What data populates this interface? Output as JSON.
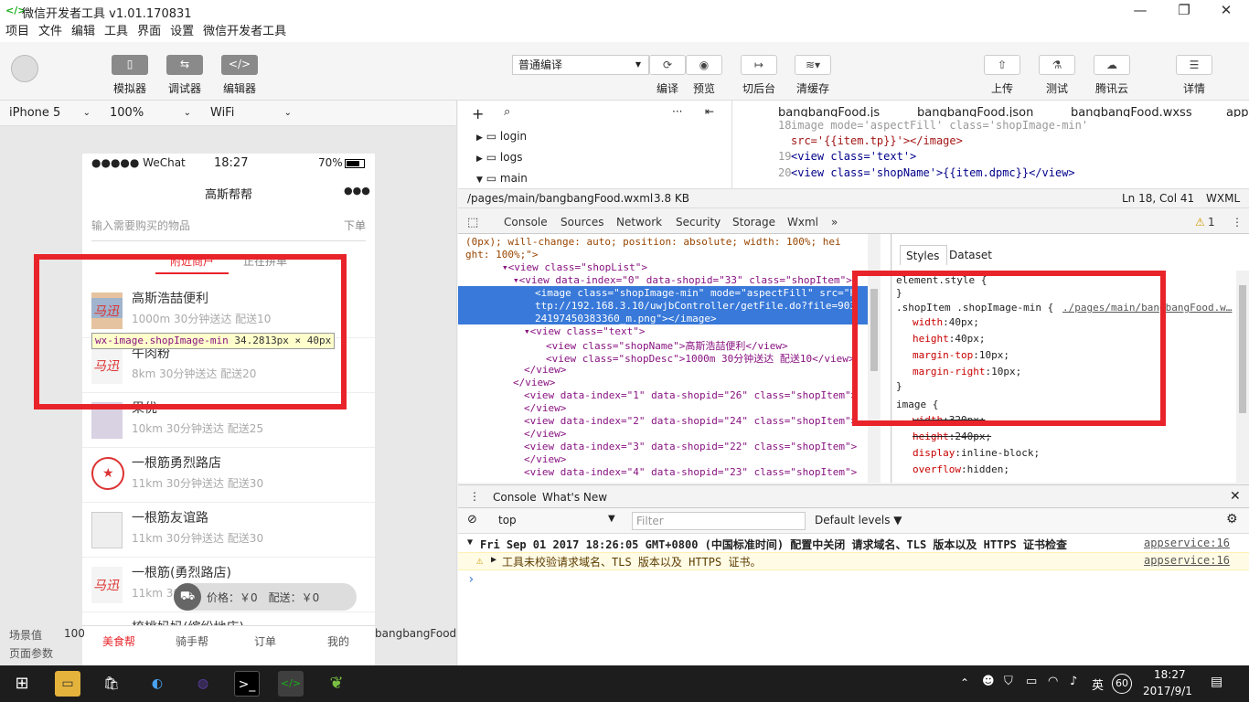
{
  "window": {
    "title": "微信开发者工具 v1.01.170831",
    "icon": "code-icon",
    "minimize": "—",
    "restore": "❐",
    "close": "✕"
  },
  "menu": [
    "项目",
    "文件",
    "编辑",
    "工具",
    "界面",
    "设置",
    "微信开发者工具"
  ],
  "toolbar": {
    "simulator": "模拟器",
    "debugger": "调试器",
    "editor": "编辑器",
    "compile_mode": "普通编译",
    "compile": "编译",
    "preview": "预览",
    "background": "切后台",
    "clear_cache": "清缓存",
    "upload": "上传",
    "test": "测试",
    "tencent_cloud": "腾讯云",
    "details": "详情"
  },
  "device_bar": {
    "device": "iPhone 5",
    "zoom": "100%",
    "network": "WiFi"
  },
  "phone": {
    "status": {
      "carrier": "●●●●● WeChat",
      "time": "18:27",
      "battery": "70%"
    },
    "nav_title": "高斯帮帮",
    "nav_more": "●●●",
    "search_placeholder": "输入需要购买的物品",
    "order_button": "下单",
    "tab_nearby": "附近商户",
    "tab_group": "正在拼单",
    "shops": [
      {
        "name": "高斯浩喆便利",
        "desc": "1000m 30分钟送达 配送10"
      },
      {
        "name": "牛肉粉",
        "desc": "8km 30分钟送达 配送20"
      },
      {
        "name": "果优",
        "desc": "10km 30分钟送达 配送25"
      },
      {
        "name": "一根筋勇烈路店",
        "desc": "11km 30分钟送达 配送30"
      },
      {
        "name": "一根筋友谊路",
        "desc": "11km 30分钟送达 配送30"
      },
      {
        "name": "一根筋(勇烈路店)",
        "desc": "11km 30分"
      },
      {
        "name": "梳桃妈妈(缤纷地店)",
        "desc": ""
      }
    ],
    "tooltip": {
      "selector": "wx-image.shopImage-min",
      "size": "34.2813px × 40px"
    },
    "cart": "价格：￥0　配送：￥0",
    "bottom_tabs": [
      "美食帮",
      "骑手帮",
      "订单",
      "我的"
    ]
  },
  "left_bottom": {
    "scene_label": "场景值",
    "scene_value": "100",
    "page_params": "页面参数",
    "path_fragment": "bangbangFood"
  },
  "file_tree": [
    "login",
    "logs",
    "main"
  ],
  "editor_tabs": [
    "bangbangFood.js",
    "bangbangFood.json",
    "bangbangFood.wxss",
    "app."
  ],
  "code": [
    {
      "line": "18",
      "text": "  image mode='aspectFill' class='shopImage-min'"
    },
    {
      "line": "",
      "text": "src='{{item.tp}}'></image>"
    },
    {
      "line": "19",
      "text": "  <view class='text'>"
    },
    {
      "line": "20",
      "text": "    <view class='shopName'>{{item.dpmc}}</view>"
    }
  ],
  "status_line": {
    "path": "/pages/main/bangbangFood.wxml",
    "size": "3.8 KB",
    "cursor": "Ln 18, Col 41",
    "lang": "WXML"
  },
  "devtools_tabs": [
    "Console",
    "Sources",
    "Network",
    "Security",
    "Storage",
    "Wxml",
    "»"
  ],
  "devtools_warning_count": "1",
  "elements": [
    "(0px); will-change: auto; position: absolute; width: 100%; hei",
    "ght: 100%;\">",
    "▾<view class=\"shopList\">",
    "▾<view data-index=\"0\" data-shopid=\"33\" class=\"shopItem\">",
    "<image class=\"shopImage-min\" mode=\"aspectFill\" src=\"h",
    "ttp://192.168.3.10/uwjbController/getFile.do?file=903",
    "24197450383360_m.png\"></image>",
    "▾<view class=\"text\">",
    "<view class=\"shopName\">高斯浩喆便利</view>",
    "<view class=\"shopDesc\">1000m 30分钟送达 配送10</view>",
    "</view>",
    "</view>",
    "<view data-index=\"1\" data-shopid=\"26\" class=\"shopItem\">",
    "</view>",
    "<view data-index=\"2\" data-shopid=\"24\" class=\"shopItem\">",
    "</view>",
    "<view data-index=\"3\" data-shopid=\"22\" class=\"shopItem\">",
    "</view>",
    "<view data-index=\"4\" data-shopid=\"23\" class=\"shopItem\">"
  ],
  "styles_tabs": [
    "Styles",
    "Dataset"
  ],
  "styles": {
    "element_style": "element.style {",
    "close": "}",
    "rule1_selector": ".shopItem .shopImage-min {",
    "rule1_source": "./pages/main/bangbangFood.w…",
    "rule1_props": [
      [
        "width",
        "40px;"
      ],
      [
        "height",
        "40px;"
      ],
      [
        "margin-top",
        "10px;"
      ],
      [
        "margin-right",
        "10px;"
      ]
    ],
    "rule2_selector": "image {",
    "rule2_props": [
      [
        "width",
        "320px;"
      ],
      [
        "height",
        "240px;"
      ],
      [
        "display",
        "inline-block;"
      ],
      [
        "overflow",
        "hidden;"
      ]
    ]
  },
  "console": {
    "tab_console": "Console",
    "tab_whatsnew": "What's New",
    "context": "top",
    "filter_placeholder": "Filter",
    "levels": "Default levels ▼",
    "msg1": "Fri Sep 01 2017 18:26:05 GMT+0800 (中国标准时间) 配置中关闭 请求域名、TLS 版本以及 HTTPS 证书检查",
    "msg1_src": "appservice:16",
    "msg2": "工具未校验请求域名、TLS 版本以及 HTTPS 证书。",
    "msg2_src": "appservice:16",
    "prompt": "›"
  },
  "taskbar": {
    "ime": "英",
    "badge": "60",
    "time": "18:27",
    "date": "2017/9/1"
  },
  "colors": {
    "accent": "#1aad19",
    "highlight": "#3879d9",
    "red_box": "#e8242a"
  }
}
